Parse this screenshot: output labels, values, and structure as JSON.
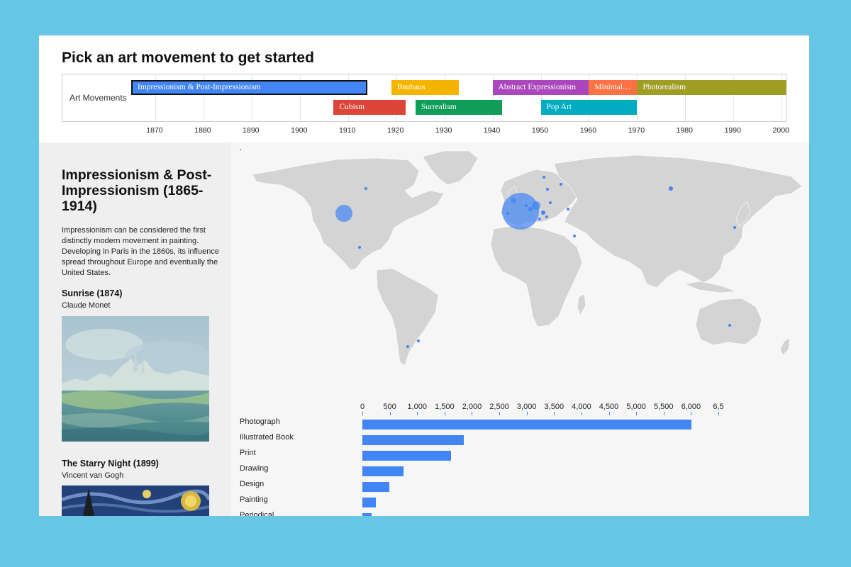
{
  "page": {
    "heading": "Pick an art movement to get started"
  },
  "timeline": {
    "row_label": "Art Movements",
    "start_year": 1865,
    "end_year": 2001,
    "years": [
      "1870",
      "1880",
      "1890",
      "1900",
      "1910",
      "1920",
      "1930",
      "1940",
      "1950",
      "1960",
      "1970",
      "1980",
      "1990",
      "2000"
    ],
    "movements": [
      {
        "id": "impressionism",
        "label": "Impressionism & Post-Impressionism",
        "start": 1865,
        "end": 1914,
        "row": 0,
        "color": "#4285f4",
        "selected": true
      },
      {
        "id": "bauhaus",
        "label": "Bauhaus",
        "start": 1919,
        "end": 1933,
        "row": 0,
        "color": "#f4b400",
        "selected": false
      },
      {
        "id": "abstract-expressionism",
        "label": "Abstract Expressionism",
        "start": 1940,
        "end": 1960,
        "row": 0,
        "color": "#ab47bc",
        "selected": false
      },
      {
        "id": "minimalism",
        "label": "Minimal…",
        "start": 1960,
        "end": 1970,
        "row": 0,
        "color": "#ff7043",
        "selected": false
      },
      {
        "id": "photorealism",
        "label": "Photorealism",
        "start": 1970,
        "end": 2001,
        "row": 0,
        "color": "#9e9d24",
        "selected": false
      },
      {
        "id": "cubism",
        "label": "Cubism",
        "start": 1907,
        "end": 1922,
        "row": 1,
        "color": "#db4437",
        "selected": false
      },
      {
        "id": "surrealism",
        "label": "Surrealism",
        "start": 1924,
        "end": 1942,
        "row": 1,
        "color": "#0f9d58",
        "selected": false
      },
      {
        "id": "pop-art",
        "label": "Pop Art",
        "start": 1950,
        "end": 1970,
        "row": 1,
        "color": "#00acc1",
        "selected": false
      }
    ]
  },
  "sidebar": {
    "title": "Impressionism & Post-Impressionism (1865-1914)",
    "description": "Impressionism can be considered the first distinctly modern movement in painting. Developing in Paris in the 1860s, its influence spread throughout Europe and eventually the United States.",
    "artworks": [
      {
        "title": "Sunrise (1874)",
        "artist": "Claude Monet"
      },
      {
        "title": "The Starry Night (1899)",
        "artist": "Vincent van Gogh"
      }
    ]
  },
  "chart_data": {
    "type": "bar",
    "orientation": "horizontal",
    "categories": [
      "Photograph",
      "Illustrated Book",
      "Print",
      "Drawing",
      "Design",
      "Painting",
      "Periodical"
    ],
    "values": [
      6010,
      1850,
      1620,
      750,
      490,
      250,
      170
    ],
    "xticks": [
      "0",
      "500",
      "1,000",
      "1,500",
      "2,000",
      "2,500",
      "3,000",
      "3,500",
      "4,000",
      "4,500",
      "5,000",
      "5,500",
      "6,000",
      "6,5"
    ],
    "xlim": [
      0,
      6500
    ],
    "axis_position": "top",
    "bar_color": "#4285f4"
  }
}
